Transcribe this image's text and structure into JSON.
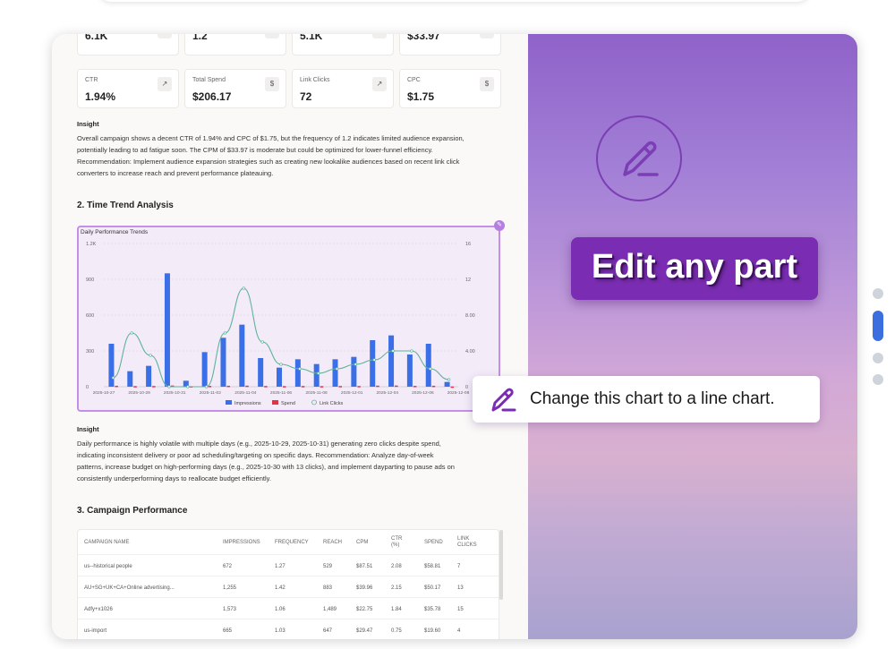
{
  "metrics_row1": [
    {
      "value": "6.1K",
      "icon": "chart-icon"
    },
    {
      "value": "1.2",
      "icon": "chart-icon"
    },
    {
      "value": "5.1K",
      "icon": "users-icon"
    },
    {
      "value": "$33.97",
      "icon": "dollar-icon"
    }
  ],
  "metrics_row2": [
    {
      "label": "CTR",
      "value": "1.94%",
      "icon": "cursor-icon"
    },
    {
      "label": "Total Spend",
      "value": "$206.17",
      "icon": "dollar-icon"
    },
    {
      "label": "Link Clicks",
      "value": "72",
      "icon": "cursor-icon"
    },
    {
      "label": "CPC",
      "value": "$1.75",
      "icon": "dollar-icon"
    }
  ],
  "insight1": {
    "heading": "Insight",
    "lines": [
      "Overall campaign shows a decent CTR of 1.94% and CPC of $1.75, but the frequency of 1.2 indicates limited audience expansion,",
      "potentially leading to ad fatigue soon. The CPM of $33.97 is moderate but could be optimized for lower-funnel efficiency.",
      "Recommendation: Implement audience expansion strategies such as creating new lookalike audiences based on recent link click",
      "converters to increase reach and prevent performance plateauing."
    ]
  },
  "section2": {
    "title": "2. Time Trend Analysis"
  },
  "chart_data": {
    "type": "bar",
    "title": "Daily Performance Trends",
    "x_tick_labels": [
      "2025-10-27",
      "2025-10-29",
      "2025-10-31",
      "2025-11-02",
      "2025-11-04",
      "2025-11-06",
      "2025-11-08",
      "2025-12-01",
      "2025-12-04",
      "2025-12-06",
      "2025-12-08"
    ],
    "left_axis": {
      "ticks": [
        "0",
        "300",
        "600",
        "900",
        "1.2K"
      ],
      "ylim": [
        0,
        1200
      ]
    },
    "right_axis": {
      "ticks": [
        "0",
        "4.00",
        "8.00",
        "12",
        "16"
      ],
      "ylim": [
        0,
        16
      ]
    },
    "series": [
      {
        "name": "Impressions",
        "type": "bar",
        "color": "#3b6fe8",
        "axis": "left",
        "values": [
          360,
          130,
          175,
          950,
          50,
          290,
          410,
          520,
          240,
          160,
          230,
          190,
          230,
          250,
          390,
          430,
          270,
          360,
          40
        ]
      },
      {
        "name": "Spend",
        "type": "bar",
        "color": "#e0344a",
        "axis": "left",
        "values": [
          8,
          5,
          6,
          10,
          4,
          7,
          8,
          9,
          6,
          5,
          6,
          5,
          6,
          6,
          9,
          10,
          7,
          8,
          2
        ]
      },
      {
        "name": "Link Clicks",
        "type": "line",
        "color": "#5fb39a",
        "axis": "right",
        "values": [
          1,
          6,
          3.5,
          0,
          0,
          0,
          6,
          11,
          5,
          2.5,
          2,
          1.5,
          2,
          2.5,
          3,
          4,
          4,
          2,
          0.8
        ]
      }
    ],
    "legend_position": "bottom",
    "grid": true
  },
  "insight2": {
    "heading": "Insight",
    "lines": [
      "Daily performance is highly volatile with multiple days (e.g., 2025-10-29, 2025-10-31) generating zero clicks despite spend,",
      "indicating inconsistent delivery or poor ad scheduling/targeting on specific days. Recommendation: Analyze day-of-week",
      "patterns, increase budget on high-performing days (e.g., 2025-10-30 with 13 clicks), and implement dayparting to pause ads on",
      "consistently underperforming days to reallocate budget efficiently."
    ]
  },
  "section3": {
    "title": "3. Campaign Performance"
  },
  "table": {
    "headers": [
      "CAMPAIGN NAME",
      "IMPRESSIONS",
      "FREQUENCY",
      "REACH",
      "CPM",
      "CTR (%)",
      "SPEND",
      "LINK CLICKS"
    ],
    "rows": [
      [
        "us--historical people",
        "672",
        "1.27",
        "529",
        "$87.51",
        "2.08",
        "$58.81",
        "7"
      ],
      [
        "AU+SG+UK+CA+Online advertising...",
        "1,255",
        "1.42",
        "883",
        "$39.96",
        "2.15",
        "$50.17",
        "13"
      ],
      [
        "Adfy+x1026",
        "1,573",
        "1.06",
        "1,489",
        "$22.75",
        "1.84",
        "$35.78",
        "15"
      ],
      [
        "us-import",
        "665",
        "1.03",
        "647",
        "$29.47",
        "0.75",
        "$19.60",
        "4"
      ]
    ]
  },
  "overlay": {
    "edit_label": "Edit any part",
    "prompt_text": "Change this chart to a line chart.",
    "accent_color": "#7a2db2"
  },
  "pager": {
    "pages": 4,
    "active_index": 1
  }
}
